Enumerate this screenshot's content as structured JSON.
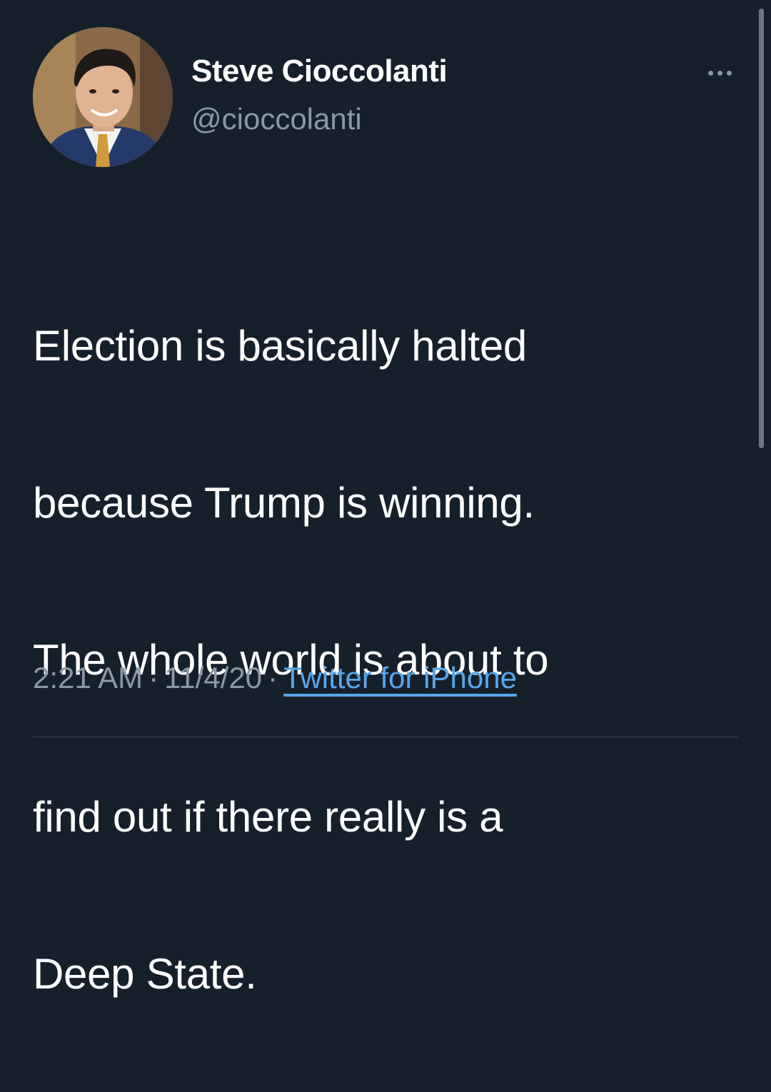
{
  "tweet": {
    "author": {
      "display_name": "Steve Cioccolanti",
      "handle": "@cioccolanti"
    },
    "text_lines": [
      "Election is basically halted",
      "because Trump is winning.",
      "The whole world is about to",
      "find out if there really is a",
      "Deep State."
    ],
    "time": "2:21 AM",
    "date": "11/4/20",
    "separator": "·",
    "source": "Twitter for iPhone",
    "more_icon": "ellipsis-icon"
  },
  "colors": {
    "background": "#15202b",
    "primary_text": "#ffffff",
    "secondary_text": "#8b98a5",
    "link": "#58a6ea",
    "divider": "#38444d"
  }
}
